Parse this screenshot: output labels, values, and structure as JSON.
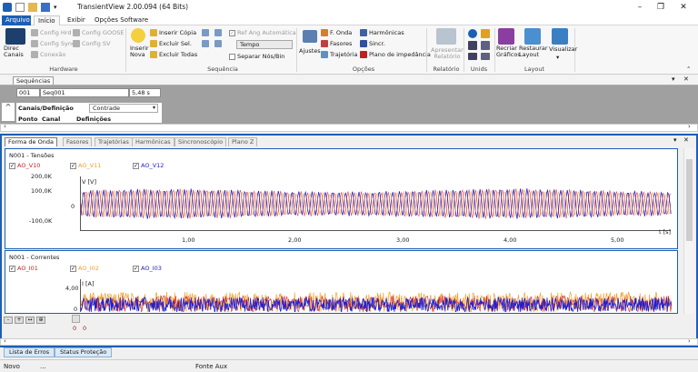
{
  "window": {
    "title": "TransientView 2.00.094 (64 Bits)"
  },
  "tabs": [
    {
      "label": "Arquivo"
    },
    {
      "label": "Início"
    },
    {
      "label": "Exibir"
    },
    {
      "label": "Opções Software"
    }
  ],
  "ribbon": {
    "hardware": {
      "group": "Hardware",
      "direc_canais": "Direc\nCanais",
      "config_hrd": "Config Hrd",
      "config_goose": "Config GOOSE",
      "config_sync": "Config Sync",
      "config_sv": "Config SV",
      "conexao": "Conexão"
    },
    "sequencia": {
      "group": "Sequência",
      "inserir_nova": "Inserir\nNova",
      "inserir_copia": "Inserir Cópia",
      "excluir_sel": "Excluir Sel.",
      "excluir_todas": "Excluir Todas",
      "ref_ang": "Ref Ang Automática",
      "tempo": "Tempo",
      "separar": "Separar Nós/Bin"
    },
    "opcoes": {
      "group": "Opções",
      "ajustes": "Ajustes",
      "f_onda": "F. Onda",
      "fasores": "Fasores",
      "trajetoria": "Trajetória",
      "harmonicas": "Harmônicas",
      "sincr": "Sincr.",
      "plano": "Plano de impedância"
    },
    "relatorio": {
      "group": "Relatório",
      "apresentar": "Apresentar\nRelatório"
    },
    "unids": {
      "group": "Unids"
    },
    "layout": {
      "group": "Layout",
      "recriar": "Recriar\nGráficos",
      "restaurar": "Restaurar\nLayout",
      "visualizar": "Visualizar"
    }
  },
  "sequencias": {
    "title": "Sequências",
    "num": "001",
    "name": "Seq001",
    "time": "5,48 s"
  },
  "canais": {
    "title": "Canais/Definição",
    "combo": "Contrade",
    "col1": "Ponto",
    "col2": "Canal",
    "col3": "Definições"
  },
  "waveTabs": [
    {
      "label": "Forma de Onda"
    },
    {
      "label": "Fasores"
    },
    {
      "label": "Trajetórias"
    },
    {
      "label": "Harmônicas"
    },
    {
      "label": "Sincronoscópio"
    },
    {
      "label": "Plano Z"
    }
  ],
  "voltage": {
    "title": "N001 - Tensões",
    "ch1": "AO_V10",
    "ch2": "AO_V11",
    "ch3": "AO_V12",
    "unit": "V [V]",
    "yticks": [
      "200,0K",
      "100,0K",
      "0",
      "-100,0K"
    ],
    "xunit": "t [s]"
  },
  "current": {
    "title": "N001 - Correntes",
    "ch1": "AO_I01",
    "ch2": "AO_I02",
    "ch3": "AO_I03",
    "unit": "I [A]",
    "yticks": [
      "4,00",
      "0"
    ]
  },
  "xticks": [
    "1,00",
    "2,00",
    "3,00",
    "4,00",
    "5,00"
  ],
  "timeline": {
    "z1": "0",
    "z2": "0"
  },
  "bottomTabs": [
    {
      "label": "Lista de Erros"
    },
    {
      "label": "Status Proteção"
    }
  ],
  "status": {
    "s1": "Novo",
    "s2": "...",
    "s3": "Fonte Aux"
  },
  "colors": {
    "red": "#d02020",
    "orange": "#f0a030",
    "blue": "#2020d0",
    "accent": "#1c5fb4"
  }
}
